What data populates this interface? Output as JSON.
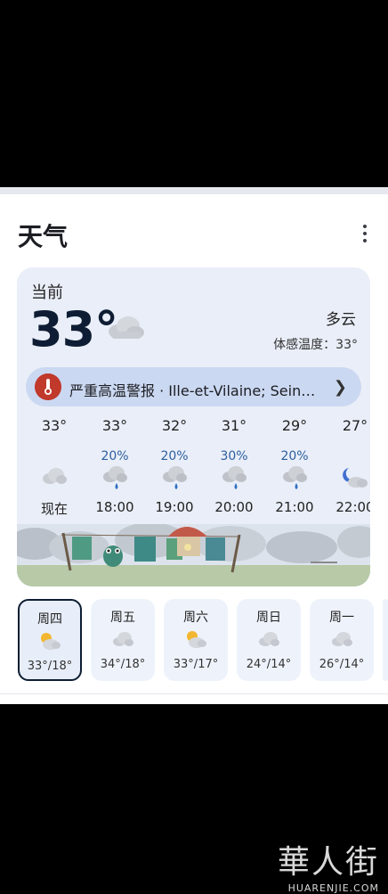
{
  "app": {
    "title": "天气"
  },
  "current": {
    "label": "当前",
    "temp": "33°",
    "condition": "多云",
    "feels_like": "体感温度：33°",
    "icon": "cloud-icon"
  },
  "alert": {
    "text": "严重高温警报 · Ille-et-Vilaine; Sein…",
    "icon": "thermometer-alert-icon",
    "color": "#c0392b"
  },
  "hourly": [
    {
      "temp": "33°",
      "pop": "",
      "icon": "cloud-icon",
      "time": "现在"
    },
    {
      "temp": "33°",
      "pop": "20%",
      "icon": "cloud-rain-icon",
      "time": "18:00"
    },
    {
      "temp": "32°",
      "pop": "20%",
      "icon": "cloud-rain-icon",
      "time": "19:00"
    },
    {
      "temp": "31°",
      "pop": "30%",
      "icon": "cloud-rain-icon",
      "time": "20:00"
    },
    {
      "temp": "29°",
      "pop": "20%",
      "icon": "cloud-rain-icon",
      "time": "21:00"
    },
    {
      "temp": "27°",
      "pop": "",
      "icon": "moon-cloud-icon",
      "time": "22:00"
    }
  ],
  "daily": [
    {
      "day": "周四",
      "range": "33°/18°",
      "icon": "sun-cloud-icon",
      "selected": true
    },
    {
      "day": "周五",
      "range": "34°/18°",
      "icon": "cloud-icon",
      "selected": false
    },
    {
      "day": "周六",
      "range": "33°/17°",
      "icon": "sun-cloud-icon",
      "selected": false
    },
    {
      "day": "周日",
      "range": "24°/14°",
      "icon": "cloud-icon",
      "selected": false
    },
    {
      "day": "周一",
      "range": "26°/14°",
      "icon": "cloud-icon",
      "selected": false
    }
  ],
  "watermark": {
    "big": "華人街",
    "small": "HUARENJIE.COM"
  },
  "colors": {
    "accent": "#0e1d33",
    "card_bg": "#e9eef8",
    "alert_bg": "#cbd8f1",
    "precip": "#2e5f9e"
  }
}
